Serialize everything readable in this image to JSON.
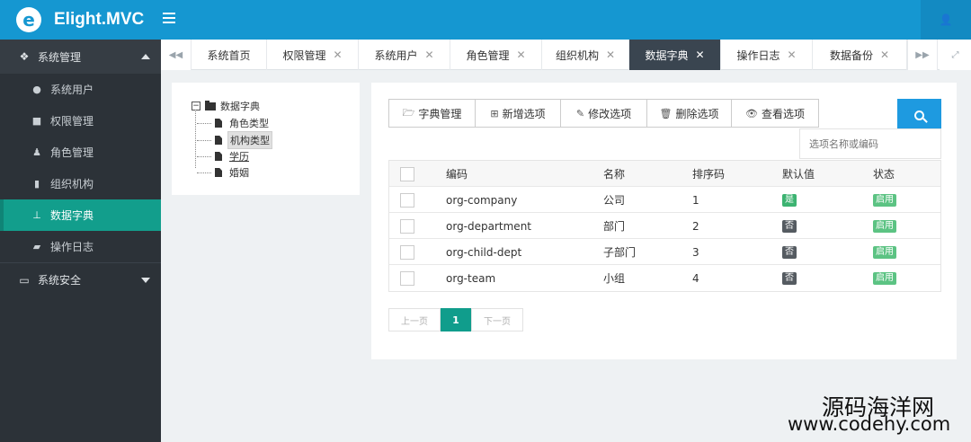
{
  "app": {
    "logo_letter": "e",
    "name": "Elight.MVC",
    "user_icon": "user-icon"
  },
  "sidebar": {
    "sections": [
      {
        "label": "系统管理",
        "icon": "cubes-icon",
        "expanded": true,
        "items": [
          {
            "label": "系统用户",
            "icon": "user-circle-icon"
          },
          {
            "label": "权限管理",
            "icon": "briefcase-icon"
          },
          {
            "label": "角色管理",
            "icon": "users-icon"
          },
          {
            "label": "组织机构",
            "icon": "building-icon"
          },
          {
            "label": "数据字典",
            "icon": "sitemap-icon",
            "active": true
          },
          {
            "label": "操作日志",
            "icon": "folder-open-icon"
          }
        ]
      },
      {
        "label": "系统安全",
        "icon": "monitor-icon",
        "expanded": false
      }
    ]
  },
  "tabs": [
    {
      "label": "系统首页",
      "closable": false
    },
    {
      "label": "权限管理",
      "closable": true
    },
    {
      "label": "系统用户",
      "closable": true
    },
    {
      "label": "角色管理",
      "closable": true
    },
    {
      "label": "组织机构",
      "closable": true
    },
    {
      "label": "数据字典",
      "closable": true,
      "active": true
    },
    {
      "label": "操作日志",
      "closable": true
    },
    {
      "label": "数据备份",
      "closable": true
    }
  ],
  "tree": {
    "root": "数据字典",
    "toggle": "−",
    "children": [
      {
        "label": "角色类型"
      },
      {
        "label": "机构类型",
        "selected": true
      },
      {
        "label": "学历",
        "underlined": true
      },
      {
        "label": "婚姻"
      }
    ]
  },
  "toolbar": {
    "buttons": [
      {
        "label": "字典管理",
        "glyph": "🗁"
      },
      {
        "label": "新增选项",
        "glyph": "⊞"
      },
      {
        "label": "修改选项",
        "glyph": "✎"
      },
      {
        "label": "删除选项",
        "glyph": "🗑"
      },
      {
        "label": "查看选项",
        "glyph": "👁"
      }
    ],
    "search_placeholder": "选项名称或编码"
  },
  "grid": {
    "columns": [
      "编码",
      "名称",
      "排序码",
      "默认值",
      "状态"
    ],
    "rows": [
      {
        "code": "org-company",
        "name": "公司",
        "sort": "1",
        "default": "是",
        "status": "启用"
      },
      {
        "code": "org-department",
        "name": "部门",
        "sort": "2",
        "default": "否",
        "status": "启用"
      },
      {
        "code": "org-child-dept",
        "name": "子部门",
        "sort": "3",
        "default": "否",
        "status": "启用"
      },
      {
        "code": "org-team",
        "name": "小组",
        "sort": "4",
        "default": "否",
        "status": "启用"
      }
    ]
  },
  "pager": {
    "prev": "上一页",
    "current": "1",
    "next": "下一页"
  },
  "watermark": {
    "line1": "源码海洋网",
    "line2": "www.codehy.com"
  }
}
